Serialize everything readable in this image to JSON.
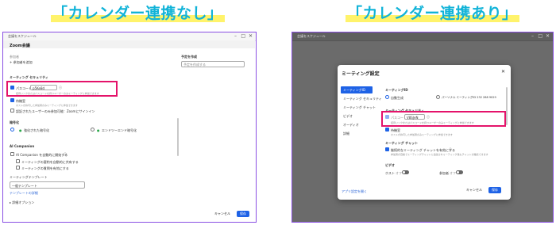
{
  "captions": {
    "left": "「カレンダー連携なし」",
    "right": "「カレンダー連携あり」"
  },
  "left": {
    "window_title": "会議をスケジュール",
    "calendar_label": "Zoom会議",
    "attendees_label": "参加者",
    "add_attendee": "+ 参加者を追加",
    "template_label": "予定を作成",
    "template_placeholder": "予定を作成する",
    "security_header": "ミーティング セキュリティ",
    "passcode_label": "パスコード",
    "passcode_value": "p5Ke8d",
    "passcode_hint": "招待リンクまたはパスコードを持つユーザーのみミーティングに参加できます",
    "waiting_room_label": "待機室",
    "waiting_room_hint": "ホストが許可した参加者のみミーティングに参加できます",
    "auth_label": "認証されたユーザーのみ参加可能：Zoomにサインイン",
    "encryption_header": "暗号化",
    "encryption_enhanced": "強化された暗号化",
    "encryption_e2e": "エンドツーエンド暗号化",
    "ai_header": "AI Companion",
    "ai_auto": "AI Companion を自動的に開始する",
    "ai_summary": "ミーティングの要約を自動的に共有する",
    "ai_questions": "ミーティングの質問を有効にする",
    "template_header": "ミーティングテンプレート",
    "template_value": "一般テンプレート",
    "template_link": "テンプレートの詳細",
    "more": "▸ 詳細オプション",
    "cancel": "キャンセル",
    "save": "保存"
  },
  "right": {
    "window_title": "会議をスケジュール",
    "dialog_title": "ミーティング設定",
    "nav": [
      "ミーティングID",
      "ミーティング セキュリティ",
      "ミーティング チャット",
      "ビデオ",
      "オーディオ",
      "詳細"
    ],
    "meeting_id_header": "ミーティングID",
    "auto_generate": "自動生成",
    "personal_id": "パーソナル ミーティングID 232 288 9029",
    "security_header": "ミーティング セキュリティ",
    "passcode_label": "パスコード",
    "passcode_value": "V8SJeN",
    "passcode_hint": "招待リンクまたはパスコードを持つユーザーのみミーティングに参加できます",
    "waiting_room_label": "待機室",
    "waiting_room_hint": "ホストが許可した参加者のみミーティングに参加できます",
    "chat_header": "ミーティング チャット",
    "chat_label": "継続的なミーティング チャットを有効にする",
    "chat_hint": "参加者が自動でミーティングチャットに追加されミーティング後もチャットが継続できます",
    "video_header": "ビデオ",
    "host_label": "ホスト",
    "host_state": "オフ",
    "participant_label": "参加者",
    "participant_state": "オフ",
    "settings_link": "アプリ設定を開く",
    "cancel": "キャンセル",
    "save": "保存"
  }
}
